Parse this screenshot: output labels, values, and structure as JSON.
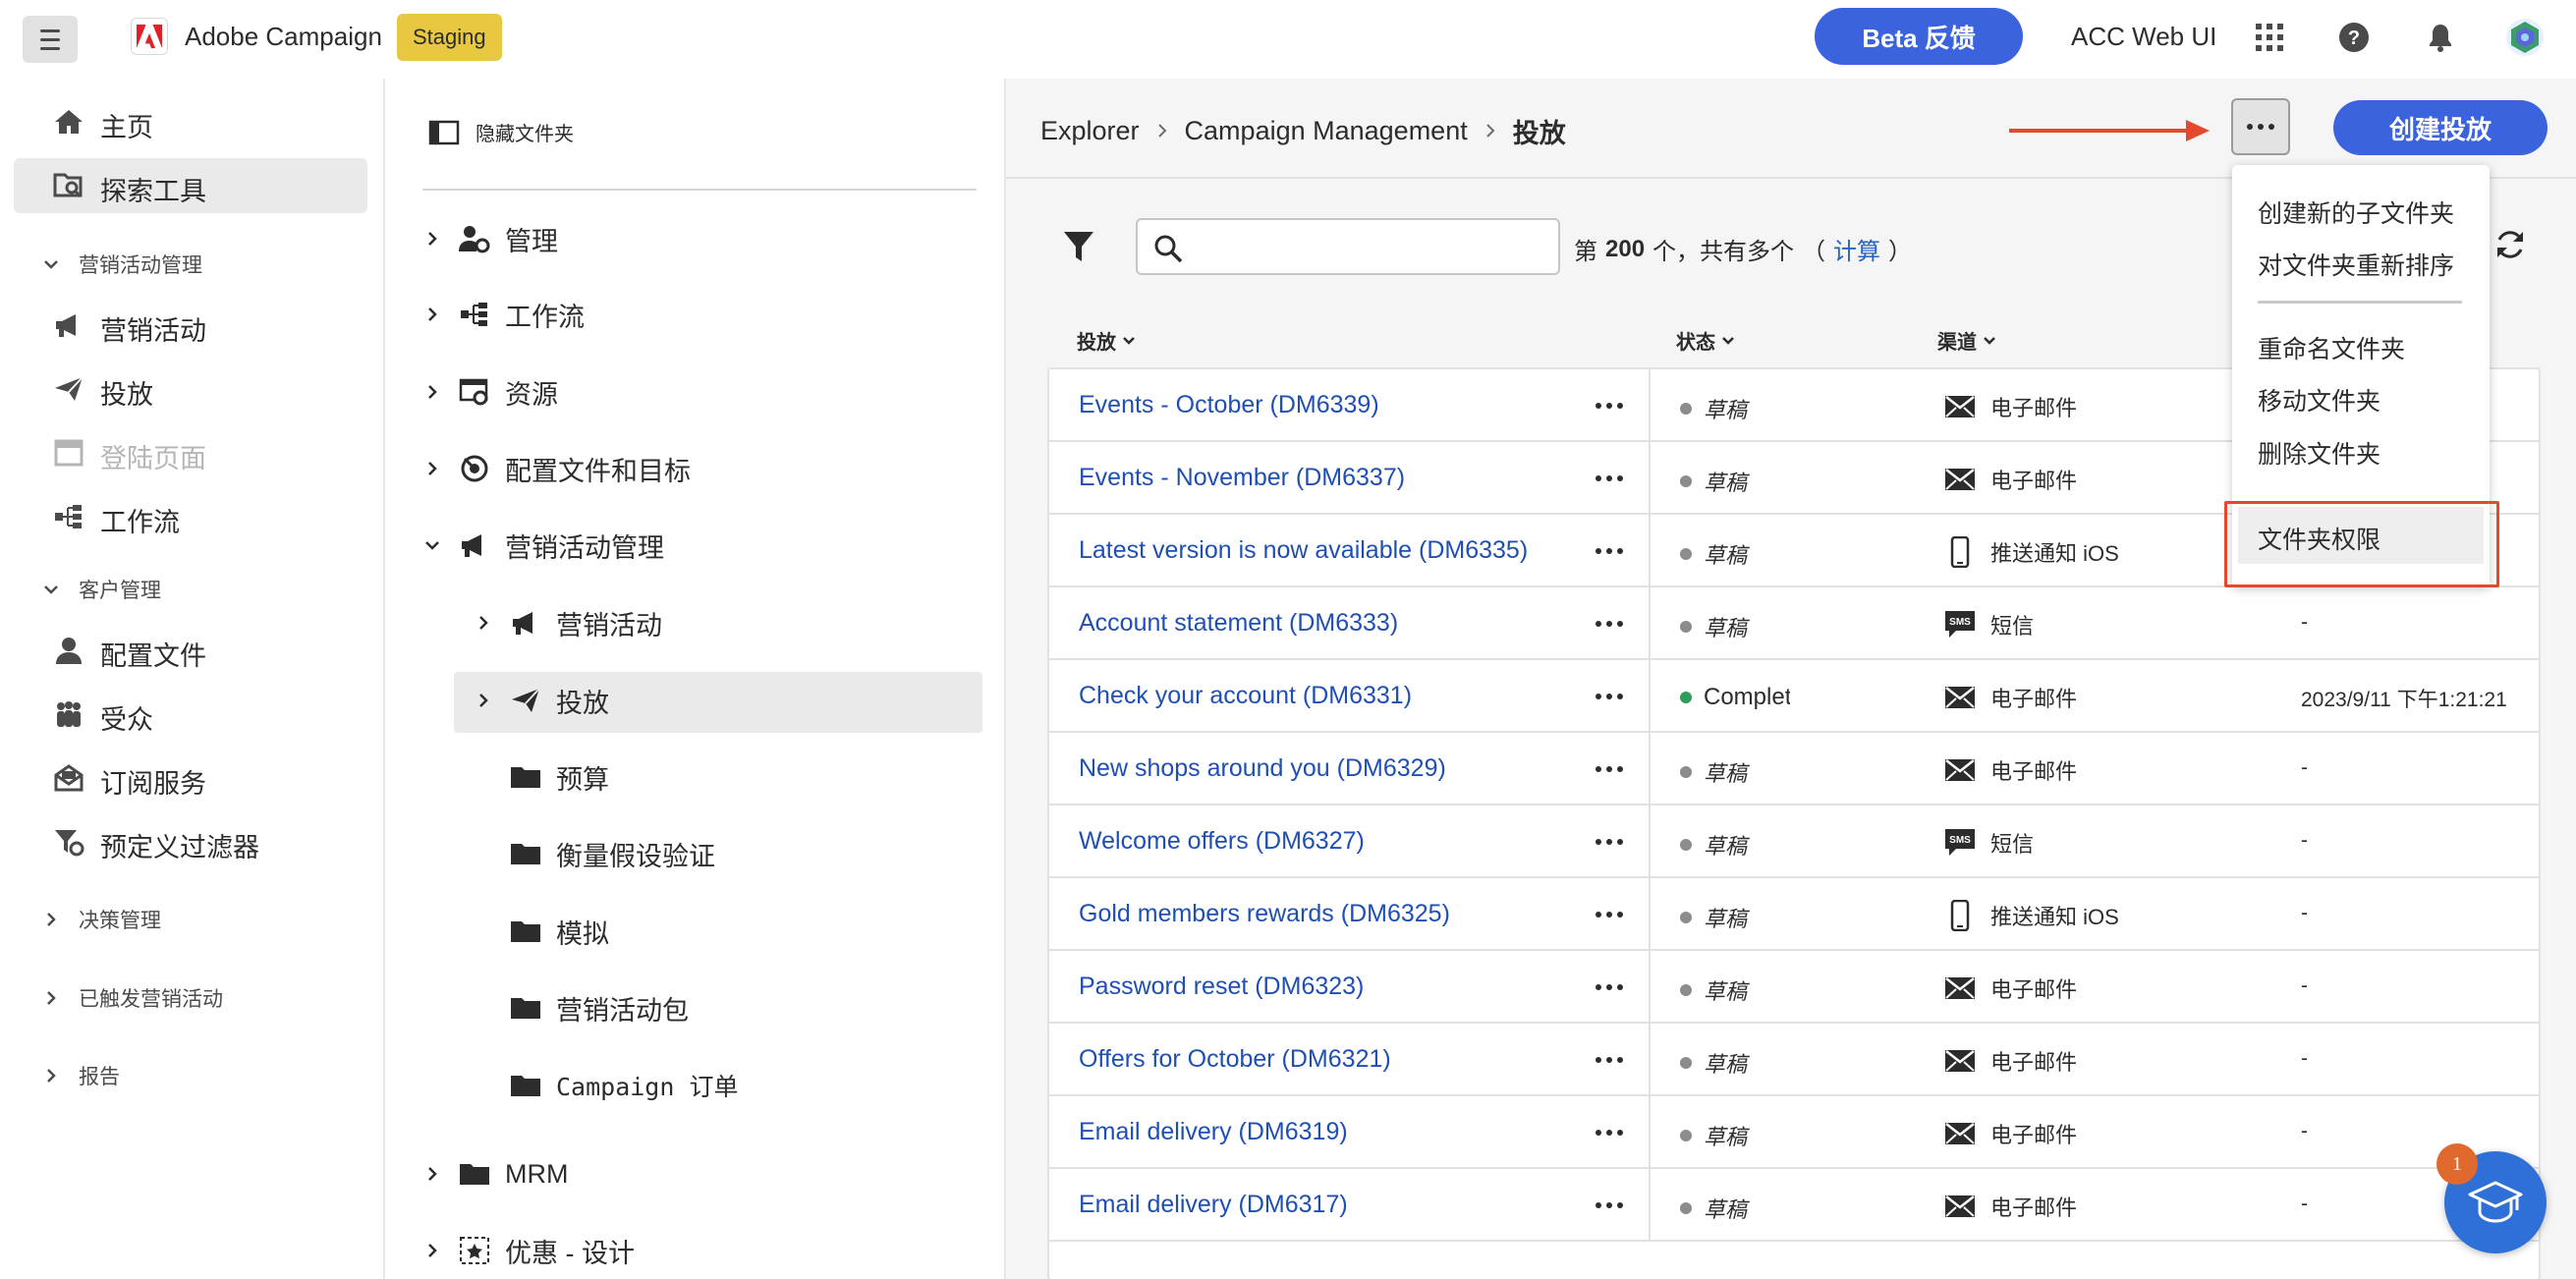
{
  "header": {
    "app_name": "Adobe Campaign",
    "env_badge": "Staging",
    "beta_button": "Beta 反馈",
    "product_label": "ACC Web UI"
  },
  "leftnav": {
    "home": "主页",
    "explorer": "探索工具",
    "section_campaign_mgmt": "营销活动管理",
    "campaigns": "营销活动",
    "deliveries": "投放",
    "landing_pages": "登陆页面",
    "workflows": "工作流",
    "section_customer_mgmt": "客户管理",
    "profiles": "配置文件",
    "audiences": "受众",
    "subscription_services": "订阅服务",
    "predefined_filters": "预定义过滤器",
    "section_decision_mgmt": "决策管理",
    "section_triggered": "已触发营销活动",
    "section_reports": "报告"
  },
  "tree": {
    "hide_folders": "隐藏文件夹",
    "admin": "管理",
    "workflow": "工作流",
    "resources": "资源",
    "profiles_targets": "配置文件和目标",
    "campaign_mgmt": "营销活动管理",
    "campaigns": "营销活动",
    "deliveries": "投放",
    "budgets": "预算",
    "hypotheses": "衡量假设验证",
    "simulations": "模拟",
    "campaign_packages": "营销活动包",
    "campaign_orders": "Campaign 订单",
    "mrm": "MRM",
    "offer_design": "优惠 - 设计"
  },
  "breadcrumb": {
    "root": "Explorer",
    "middle": "Campaign Management",
    "current": "投放"
  },
  "toolbar": {
    "create_button": "创建投放",
    "search_placeholder": "",
    "count_prefix": "第",
    "count_value": "200",
    "count_suffix": "个，共有多个",
    "calc_open": "（",
    "calc_link": "计算",
    "calc_close": "）"
  },
  "table": {
    "col_delivery": "投放",
    "col_status": "状态",
    "col_channel": "渠道",
    "rows": [
      {
        "name": "Events - October (DM6339)",
        "status": "草稿",
        "channel": "电子邮件",
        "channel_icon": "email-icon",
        "date": ""
      },
      {
        "name": "Events - November (DM6337)",
        "status": "草稿",
        "channel": "电子邮件",
        "channel_icon": "email-icon",
        "date": ""
      },
      {
        "name": "Latest version is now available (DM6335)",
        "status": "草稿",
        "channel": "推送通知 iOS",
        "channel_icon": "mobile-icon",
        "date": ""
      },
      {
        "name": "Account statement (DM6333)",
        "status": "草稿",
        "channel": "短信",
        "channel_icon": "sms-icon",
        "date": "-"
      },
      {
        "name": "Check your account (DM6331)",
        "status": "Completed",
        "channel": "电子邮件",
        "channel_icon": "email-icon",
        "date": "2023/9/11 下午1:21:21"
      },
      {
        "name": "New shops around you (DM6329)",
        "status": "草稿",
        "channel": "电子邮件",
        "channel_icon": "email-icon",
        "date": "-"
      },
      {
        "name": "Welcome offers (DM6327)",
        "status": "草稿",
        "channel": "短信",
        "channel_icon": "sms-icon",
        "date": "-"
      },
      {
        "name": "Gold members rewards (DM6325)",
        "status": "草稿",
        "channel": "推送通知 iOS",
        "channel_icon": "mobile-icon",
        "date": "-"
      },
      {
        "name": "Password reset (DM6323)",
        "status": "草稿",
        "channel": "电子邮件",
        "channel_icon": "email-icon",
        "date": "-"
      },
      {
        "name": "Offers for October (DM6321)",
        "status": "草稿",
        "channel": "电子邮件",
        "channel_icon": "email-icon",
        "date": "-"
      },
      {
        "name": "Email delivery (DM6319)",
        "status": "草稿",
        "channel": "电子邮件",
        "channel_icon": "email-icon",
        "date": "-"
      },
      {
        "name": "Email delivery (DM6317)",
        "status": "草稿",
        "channel": "电子邮件",
        "channel_icon": "email-icon",
        "date": "-"
      }
    ]
  },
  "menu": {
    "create_subfolder": "创建新的子文件夹",
    "reorder": "对文件夹重新排序",
    "rename": "重命名文件夹",
    "move": "移动文件夹",
    "delete": "删除文件夹",
    "permissions": "文件夹权限"
  },
  "help": {
    "badge_count": "1"
  },
  "colors": {
    "accent_blue": "#3b63dd",
    "link_blue": "#1f4fb4",
    "staging_yellow": "#e8c840",
    "annotation_red": "#e34a2d",
    "status_draft": "#8c8c8c",
    "status_completed": "#2d9d5c"
  }
}
